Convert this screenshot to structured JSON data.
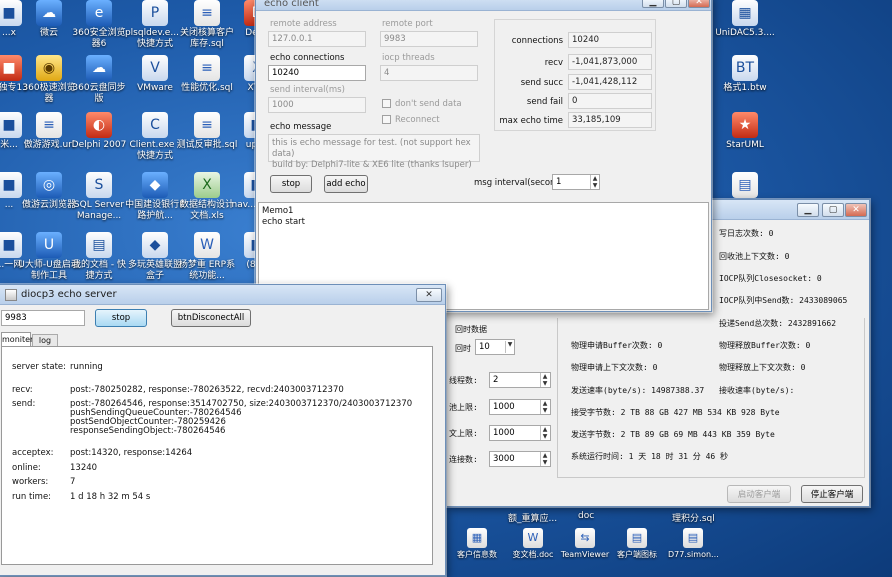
{
  "desktop": {
    "icons": [
      {
        "label": "...x",
        "glyph": "■"
      },
      {
        "label": "微云",
        "glyph": "☁"
      },
      {
        "label": "360安全浏览器6",
        "glyph": "e"
      },
      {
        "label": "plsqldev.e... - 快捷方式",
        "glyph": "P"
      },
      {
        "label": "关闭核算客户库存.sql",
        "glyph": "≡"
      },
      {
        "label": "Del...",
        "glyph": "D"
      },
      {
        "label": "...独专13",
        "glyph": "■"
      },
      {
        "label": "360极速浏览器",
        "glyph": "◉"
      },
      {
        "label": "360云盘同步版",
        "glyph": "☁"
      },
      {
        "label": "VMware",
        "glyph": "V"
      },
      {
        "label": "性能优化.sql",
        "glyph": "≡"
      },
      {
        "label": "XT...",
        "glyph": "X"
      },
      {
        "label": "米...",
        "glyph": "■"
      },
      {
        "label": "傲游游戏.url",
        "glyph": "≡"
      },
      {
        "label": "Delphi 2007",
        "glyph": "◐"
      },
      {
        "label": "Client.exe - 快捷方式",
        "glyph": "C"
      },
      {
        "label": "测试反审批.sql",
        "glyph": "≡"
      },
      {
        "label": "upl...",
        "glyph": "■"
      },
      {
        "label": "...",
        "glyph": "■"
      },
      {
        "label": "傲游云浏览器",
        "glyph": "◎"
      },
      {
        "label": "SQL Server Manage...",
        "glyph": "S"
      },
      {
        "label": "中国建设银行E路护航...",
        "glyph": "◆"
      },
      {
        "label": "数据结构设计文档.xls",
        "glyph": "X"
      },
      {
        "label": "nav... - 快...",
        "glyph": "■"
      },
      {
        "label": "...一网",
        "glyph": "■"
      },
      {
        "label": "U大师-U盘启动制作工具",
        "glyph": "U"
      },
      {
        "label": "我的文档 - 快捷方式",
        "glyph": "▤"
      },
      {
        "label": "多玩英雄联盟盒子",
        "glyph": "◆"
      },
      {
        "label": "杨梦重 ERP系统功能...",
        "glyph": "W"
      },
      {
        "label": "(8)...",
        "glyph": "■"
      },
      {
        "label": "UniDAC5.3....",
        "glyph": "▦"
      },
      {
        "label": "格式1.btw",
        "glyph": "BT"
      },
      {
        "label": "StarUML",
        "glyph": "★"
      },
      {
        "label": "",
        "glyph": "▤"
      }
    ],
    "bottom_icons": [
      {
        "label": "客户信息数",
        "glyph": "▦"
      },
      {
        "label": "变文档.doc",
        "glyph": "W"
      },
      {
        "label": "TeamViewer",
        "glyph": "⇆"
      },
      {
        "label": "客户端图标",
        "glyph": "▤"
      },
      {
        "label": "D77.simon...",
        "glyph": "▤"
      }
    ],
    "fragments": [
      "额_重算应...",
      "doc",
      "理积分.sql"
    ]
  },
  "echo_client": {
    "title": "echo client",
    "remote_address_label": "remote address",
    "remote_address_value": "127.0.0.1",
    "remote_port_label": "remote port",
    "remote_port_value": "9983",
    "echo_connections_label": "echo connections",
    "echo_connections_value": "10240",
    "iocp_threads_label": "iocp threads",
    "iocp_threads_value": "4",
    "send_interval_label": "send interval(ms)",
    "send_interval_value": "1000",
    "dont_send_data_label": "don't send data",
    "reconnect_label": "Reconnect",
    "echo_message_label": "echo message",
    "echo_message_line1": "this is echo message for test. (not support hex data)",
    "echo_message_line2": "build by: Delphi7-lite & XE6 lite (thanks lsuper)",
    "stats": [
      {
        "label": "connections",
        "value": "10240"
      },
      {
        "label": "recv",
        "value": "-1,041,873,000"
      },
      {
        "label": "send succ",
        "value": "-1,041,428,112"
      },
      {
        "label": "send fail",
        "value": "0"
      },
      {
        "label": "max echo time",
        "value": "33,185,109"
      }
    ],
    "stop_label": "stop",
    "add_echo_label": "add echo",
    "msg_interval_label": "msg interval(seconds)",
    "msg_interval_value": "1",
    "memo_lines": [
      "Memo1",
      "echo start"
    ]
  },
  "cn_window": {
    "left_fields": [
      {
        "label": "回时数据",
        "value": ""
      },
      {
        "label": "回时",
        "value": "10"
      },
      {
        "label": "线程数:",
        "value": "2"
      },
      {
        "label": "池上限:",
        "value": "1000"
      },
      {
        "label": "文上限:",
        "value": "1000"
      },
      {
        "label": "连接数:",
        "value": "3000"
      }
    ],
    "right_lines": [
      "写日志次数:  0",
      "回收池上下文数: 0",
      "IOCP队列Closesocket:  0",
      "IOCP队列中Send数:  2433089065",
      "投递Send总次数:  2432891662"
    ],
    "pair_lines": [
      [
        "物理申请Buffer次数:  0",
        "物理释放Buffer次数:  0"
      ],
      [
        "物理申请上下文次数:  0",
        "物理释放上下文次数:  0"
      ],
      [
        "发送速率(byte/s):  14987388.37",
        "接收速率(byte/s):"
      ]
    ],
    "bytes_lines": [
      "接受字节数:  2  TB  88  GB  427  MB  534  KB  928  Byte",
      "发送字节数:  2  TB  89  GB  69  MB  443  KB  359  Byte",
      "系统运行时间:  1 天  18 时  31 分  46 秒"
    ],
    "start_client_label": "启动客户端",
    "stop_client_label": "停止客户端"
  },
  "echo_server": {
    "title": "diocp3 echo server",
    "port_value": "9983",
    "stop_label": "stop",
    "disconnect_label": "btnDisconectAll",
    "tabs": [
      "moniter",
      "log"
    ],
    "server_state_label": "server state:",
    "server_state_value": "running",
    "recv_label": "recv:",
    "recv_value": "post:-780250282, response:-780263522, recvd:2403003712370",
    "send_label": "send:",
    "send_lines": [
      "post:-780264546, response:3514702750, size:2403003712370/2403003712370",
      "pushSendingQueueCounter:-780264546",
      "postSendObjectCounter:-780259426",
      "responseSendingObject:-780264546"
    ],
    "acceptex_label": "acceptex:",
    "acceptex_value": "post:14320, response:14264",
    "online_label": "online:",
    "online_value": "13240",
    "workers_label": "workers:",
    "workers_value": "7",
    "runtime_label": "run time:",
    "runtime_value": "1 d 18 h 32 m 54 s"
  }
}
